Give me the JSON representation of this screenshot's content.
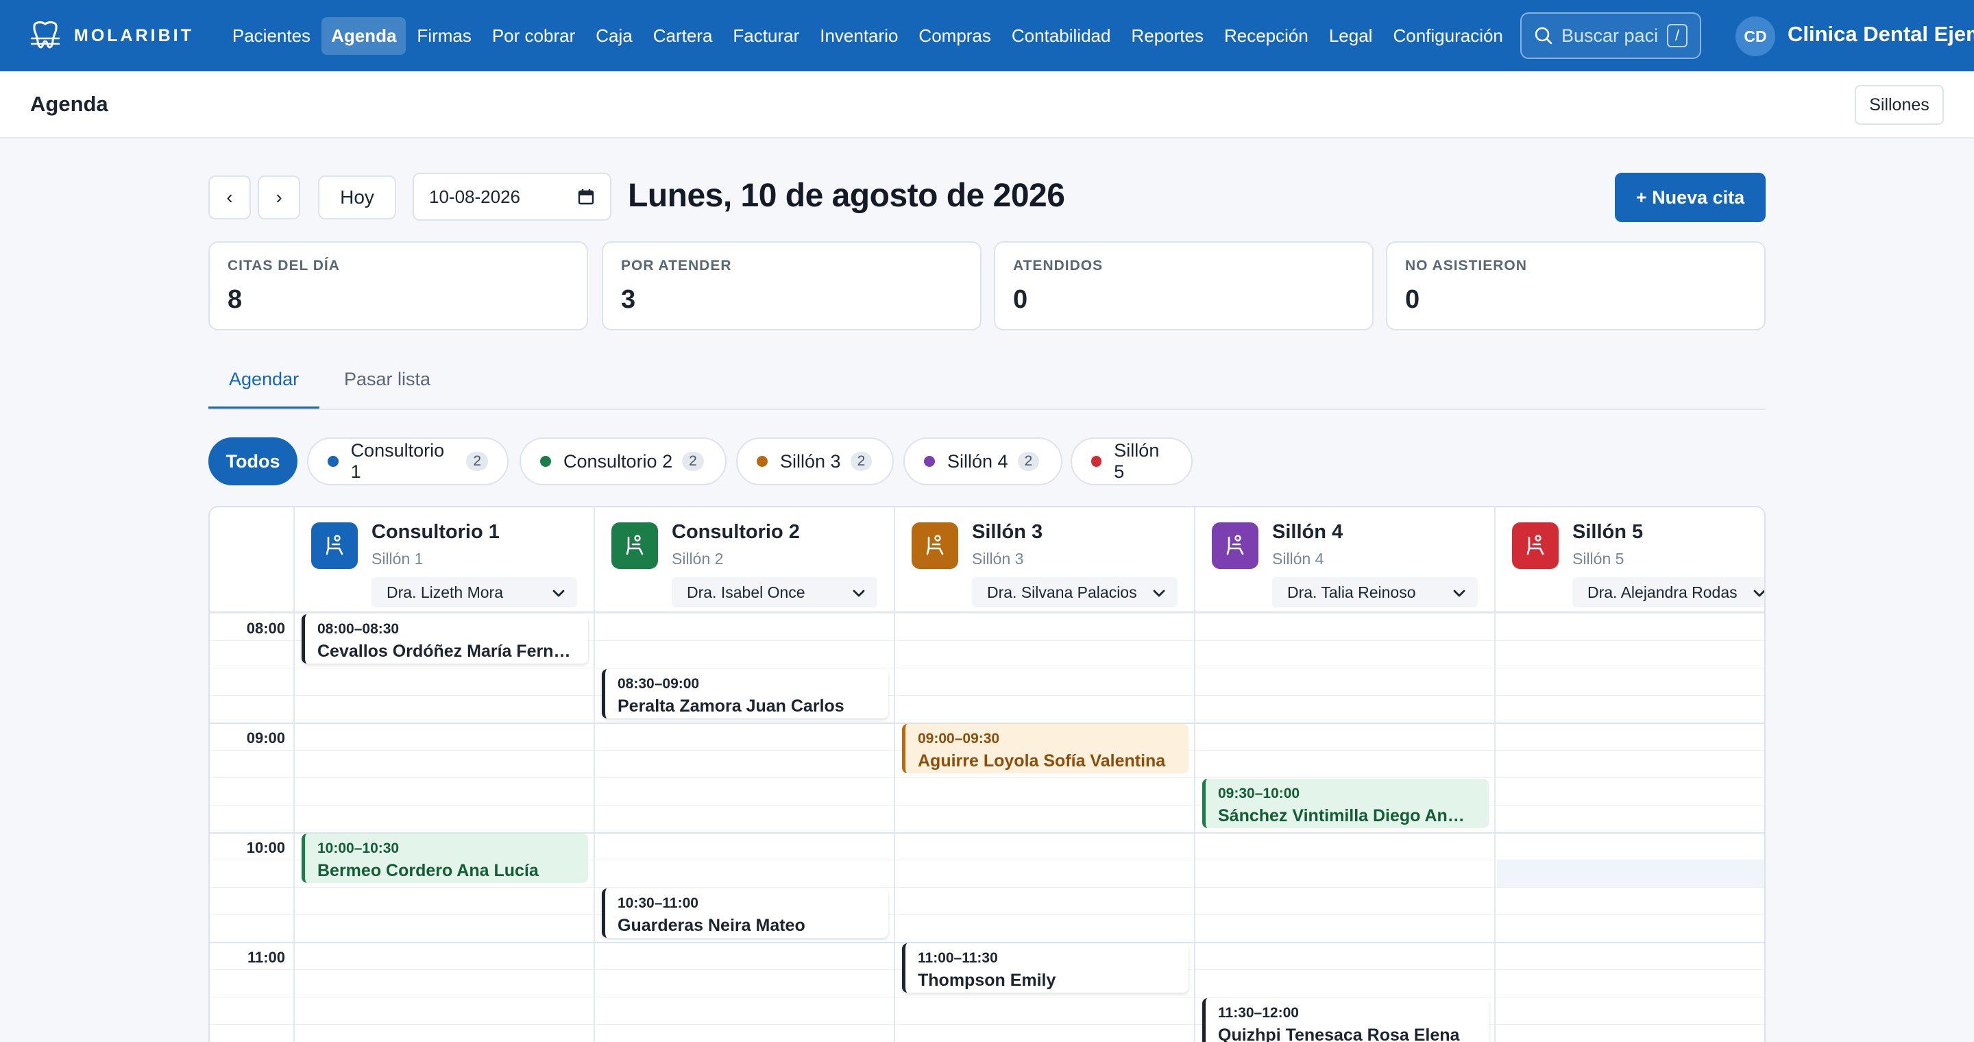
{
  "brand": {
    "name": "MOLARIBIT"
  },
  "nav": {
    "links": [
      "Pacientes",
      "Agenda",
      "Firmas",
      "Por cobrar",
      "Caja",
      "Cartera",
      "Facturar",
      "Inventario",
      "Compras",
      "Contabilidad",
      "Reportes",
      "Recepción",
      "Legal",
      "Configuración"
    ],
    "active": "Agenda",
    "search_placeholder": "Buscar paci",
    "search_shortcut": "/",
    "avatar_initials": "CD",
    "clinic_name": "Clinica Dental Ejemplo"
  },
  "page": {
    "title": "Agenda",
    "sillones_label": "Sillones"
  },
  "toolbar": {
    "prev": "‹",
    "next": "›",
    "today": "Hoy",
    "date_value": "10-08-2026",
    "date_title": "Lunes, 10 de agosto de 2026",
    "new_appt": "+ Nueva cita"
  },
  "stats": [
    {
      "label": "CITAS DEL DÍA",
      "value": "8"
    },
    {
      "label": "POR ATENDER",
      "value": "3"
    },
    {
      "label": "ATENDIDOS",
      "value": "0"
    },
    {
      "label": "NO ASISTIERON",
      "value": "0"
    }
  ],
  "tabs": [
    {
      "label": "Agendar",
      "active": true
    },
    {
      "label": "Pasar lista",
      "active": false
    }
  ],
  "chips": [
    {
      "label": "Todos",
      "active": true
    },
    {
      "label": "Consultorio 1",
      "count": "2",
      "color": "#1566b9"
    },
    {
      "label": "Consultorio 2",
      "count": "2",
      "color": "#1b7d47"
    },
    {
      "label": "Sillón 3",
      "count": "2",
      "color": "#b86a10"
    },
    {
      "label": "Sillón 4",
      "count": "2",
      "color": "#7b3fb0"
    },
    {
      "label": "Sillón 5",
      "color": "#d12b35"
    }
  ],
  "columns": [
    {
      "name": "Consultorio 1",
      "sub": "Sillón 1",
      "doctor": "Dra. Lizeth Mora",
      "color": "#1566b9"
    },
    {
      "name": "Consultorio 2",
      "sub": "Sillón 2",
      "doctor": "Dra. Isabel Once",
      "color": "#1b7d47"
    },
    {
      "name": "Sillón 3",
      "sub": "Sillón 3",
      "doctor": "Dra. Silvana Palacios",
      "color": "#b86a10"
    },
    {
      "name": "Sillón 4",
      "sub": "Sillón 4",
      "doctor": "Dra. Talia Reinoso",
      "color": "#7b3fb0"
    },
    {
      "name": "Sillón 5",
      "sub": "Sillón 5",
      "doctor": "Dra. Alejandra Rodas",
      "color": "#d12b35"
    }
  ],
  "hours": [
    "08:00",
    "09:00",
    "10:00",
    "11:00"
  ],
  "appointments": [
    {
      "time": "08:00–08:30",
      "name": "Cevallos Ordóñez María Fernanda",
      "column": 0,
      "start": "08:00",
      "style": "default"
    },
    {
      "time": "08:30–09:00",
      "name": "Peralta Zamora Juan Carlos",
      "column": 1,
      "start": "08:30",
      "style": "default"
    },
    {
      "time": "09:00–09:30",
      "name": "Aguirre Loyola Sofía Valentina",
      "column": 2,
      "start": "09:00",
      "style": "orange"
    },
    {
      "time": "09:30–10:00",
      "name": "Sánchez Vintimilla Diego Andrés",
      "column": 3,
      "start": "09:30",
      "style": "green"
    },
    {
      "time": "10:00–10:30",
      "name": "Bermeo Cordero Ana Lucía",
      "column": 0,
      "start": "10:00",
      "style": "green"
    },
    {
      "time": "10:30–11:00",
      "name": "Guarderas Neira Mateo",
      "column": 1,
      "start": "10:30",
      "style": "default"
    },
    {
      "time": "11:00–11:30",
      "name": "Thompson Emily",
      "column": 2,
      "start": "11:00",
      "style": "default"
    },
    {
      "time": "11:30–12:00",
      "name": "Quizhpi Tenesaca Rosa Elena",
      "column": 3,
      "start": "11:30",
      "style": "default"
    }
  ]
}
